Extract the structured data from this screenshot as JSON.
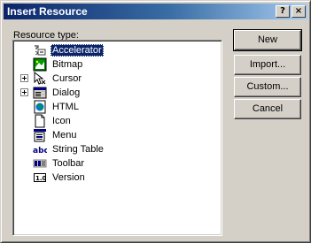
{
  "window": {
    "title": "Insert Resource"
  },
  "titlebar": {
    "help_label": "?",
    "close_label": "×"
  },
  "tree_label": "Resource type:",
  "tree": {
    "items": [
      {
        "label": "Accelerator",
        "icon": "accelerator-icon",
        "selected": true,
        "expandable": false
      },
      {
        "label": "Bitmap",
        "icon": "bitmap-icon",
        "expandable": false
      },
      {
        "label": "Cursor",
        "icon": "cursor-icon",
        "expandable": true
      },
      {
        "label": "Dialog",
        "icon": "dialog-icon",
        "expandable": true
      },
      {
        "label": "HTML",
        "icon": "html-icon",
        "expandable": false
      },
      {
        "label": "Icon",
        "icon": "icon-resource-icon",
        "expandable": false
      },
      {
        "label": "Menu",
        "icon": "menu-icon",
        "expandable": false
      },
      {
        "label": "String Table",
        "icon": "string-table-icon",
        "expandable": false
      },
      {
        "label": "Toolbar",
        "icon": "toolbar-icon",
        "expandable": false
      },
      {
        "label": "Version",
        "icon": "version-icon",
        "expandable": false
      }
    ]
  },
  "buttons": {
    "new_label": "New",
    "import_label": "Import...",
    "custom_label": "Custom...",
    "cancel_label": "Cancel"
  },
  "colors": {
    "titlebar_start": "#0a246a",
    "titlebar_end": "#a6caf0",
    "selection": "#0a246a",
    "face": "#d4d0c8"
  }
}
